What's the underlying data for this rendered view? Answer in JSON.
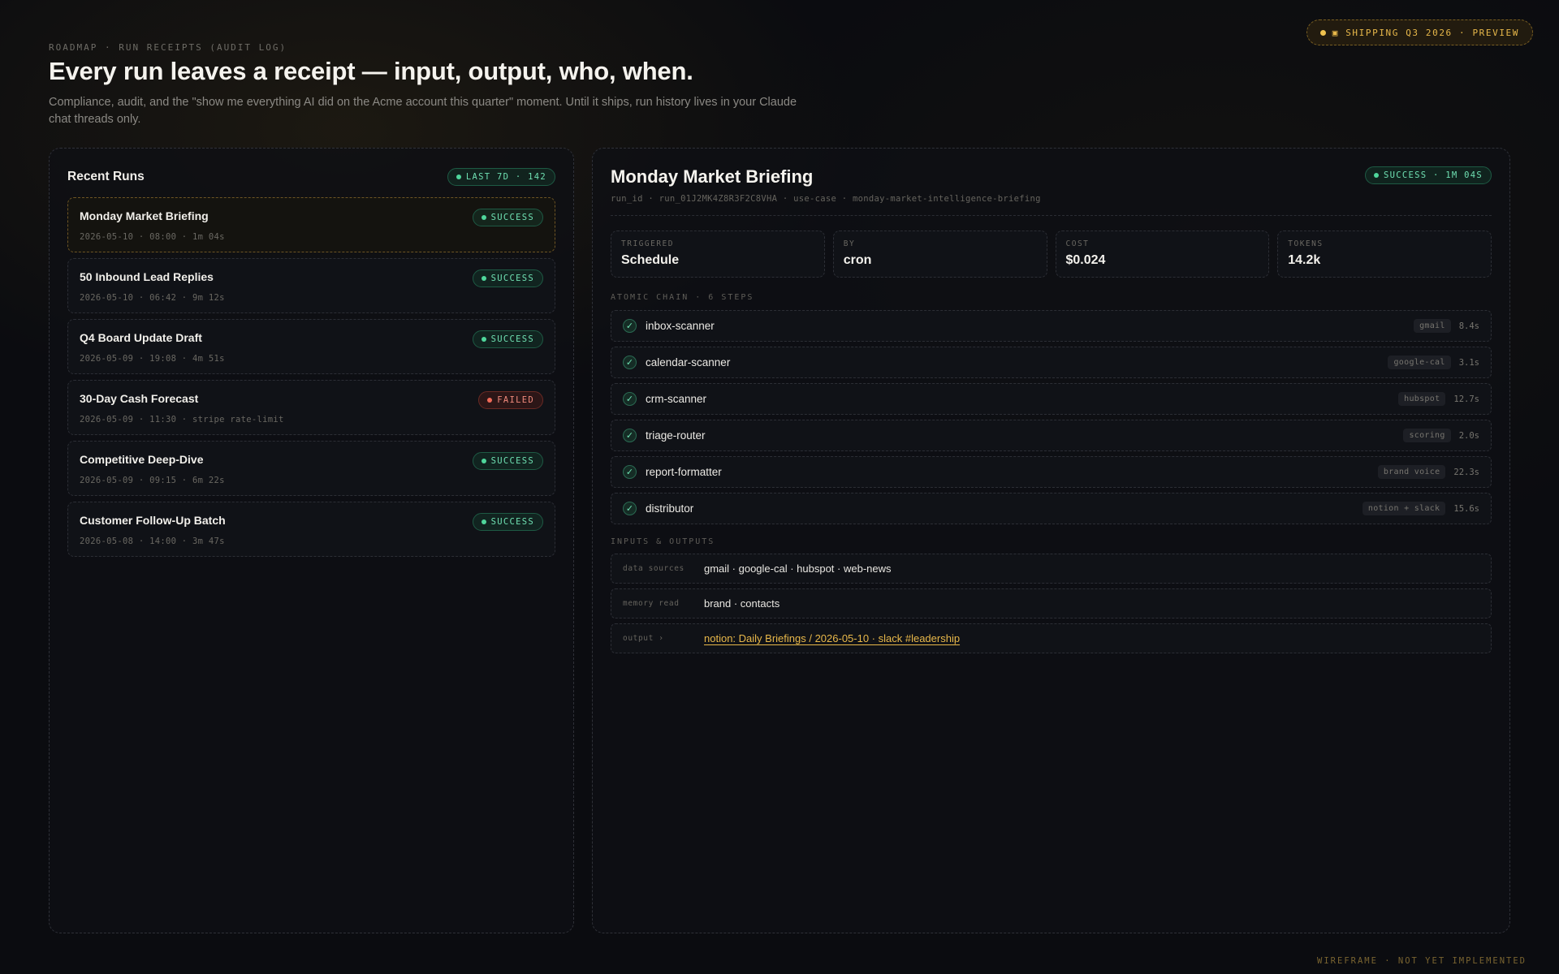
{
  "ship_pill": {
    "label": "▣ SHIPPING Q3 2026 · PREVIEW"
  },
  "header": {
    "eyebrow": "ROADMAP · RUN RECEIPTS (AUDIT LOG)",
    "title": "Every run leaves a receipt — input, output, who, when.",
    "subtitle": "Compliance, audit, and the \"show me everything AI did on the Acme account this quarter\" moment. Until it ships, run history lives in your Claude chat threads only."
  },
  "recent_runs": {
    "title": "Recent Runs",
    "badge": "LAST 7D · 142",
    "items": [
      {
        "name": "Monday Market Briefing",
        "meta": "2026-05-10 · 08:00 · 1m 04s",
        "status": "SUCCESS"
      },
      {
        "name": "50 Inbound Lead Replies",
        "meta": "2026-05-10 · 06:42 · 9m 12s",
        "status": "SUCCESS"
      },
      {
        "name": "Q4 Board Update Draft",
        "meta": "2026-05-09 · 19:08 · 4m 51s",
        "status": "SUCCESS"
      },
      {
        "name": "30-Day Cash Forecast",
        "meta": "2026-05-09 · 11:30 · stripe rate-limit",
        "status": "FAILED"
      },
      {
        "name": "Competitive Deep-Dive",
        "meta": "2026-05-09 · 09:15 · 6m 22s",
        "status": "SUCCESS"
      },
      {
        "name": "Customer Follow-Up Batch",
        "meta": "2026-05-08 · 14:00 · 3m 47s",
        "status": "SUCCESS"
      }
    ]
  },
  "detail": {
    "title": "Monday Market Briefing",
    "badge": "SUCCESS · 1M 04S",
    "ident": "run_id · run_01J2MK4Z8R3F2C8VHA · use-case · monday-market-intelligence-briefing",
    "stats": [
      {
        "label": "TRIGGERED",
        "value": "Schedule"
      },
      {
        "label": "BY",
        "value": "cron"
      },
      {
        "label": "COST",
        "value": "$0.024"
      },
      {
        "label": "TOKENS",
        "value": "14.2k"
      }
    ],
    "chain_label": "ATOMIC CHAIN · 6 STEPS",
    "steps": [
      {
        "name": "inbox-scanner",
        "tag": "gmail",
        "duration": "8.4s"
      },
      {
        "name": "calendar-scanner",
        "tag": "google-cal",
        "duration": "3.1s"
      },
      {
        "name": "crm-scanner",
        "tag": "hubspot",
        "duration": "12.7s"
      },
      {
        "name": "triage-router",
        "tag": "scoring",
        "duration": "2.0s"
      },
      {
        "name": "report-formatter",
        "tag": "brand voice",
        "duration": "22.3s"
      },
      {
        "name": "distributor",
        "tag": "notion + slack",
        "duration": "15.6s"
      }
    ],
    "io_label": "INPUTS & OUTPUTS",
    "io": [
      {
        "key": "data sources",
        "value": "gmail · google-cal · hubspot · web-news"
      },
      {
        "key": "memory read",
        "value": "brand · contacts"
      },
      {
        "key": "output ›",
        "value": "notion: Daily Briefings / 2026-05-10 · slack #leadership"
      }
    ]
  },
  "footer": "WIREFRAME · NOT YET IMPLEMENTED",
  "colors": {
    "accent": "#e8b84a",
    "success": "#4fd69b",
    "failed": "#f06a58",
    "background": "#0b0c10"
  }
}
